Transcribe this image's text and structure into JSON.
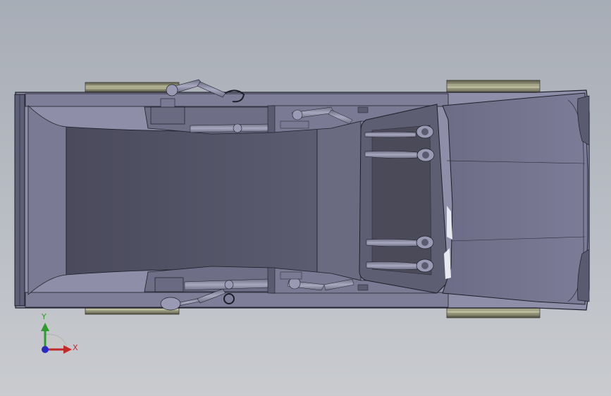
{
  "view": {
    "background_top": "#a7adb6",
    "background_bottom": "#c9cbcf",
    "model_color": "#8e8ea8",
    "model_edge_color": "#1e1e2a"
  },
  "triad": {
    "y_label": "Y",
    "x_label": "X",
    "y_color": "#2e9a2e",
    "x_color": "#c22a2a",
    "z_color": "#2a2ac2"
  }
}
